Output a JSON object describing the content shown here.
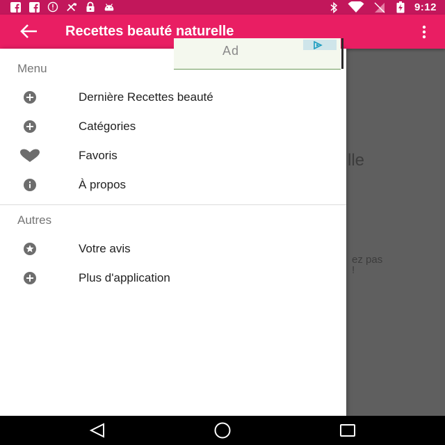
{
  "status_bar": {
    "time": "9:12",
    "left_icons": [
      "facebook-icon",
      "facebook-icon",
      "info-icon",
      "no-signal-icon",
      "lock-icon",
      "android-icon"
    ],
    "right_icons": [
      "bluetooth-icon",
      "wifi-icon",
      "no-sim-icon",
      "battery-charging-icon"
    ]
  },
  "app_bar": {
    "title": "Recettes beauté naturelle",
    "back_icon": "arrow-back-icon",
    "overflow_icon": "more-vert-icon",
    "color": "#e91e63"
  },
  "ad": {
    "label": "Ad"
  },
  "background_content": {
    "text_1": "lle",
    "text_2_line1": "ez pas",
    "text_2_line2": "!"
  },
  "drawer": {
    "sections": [
      {
        "header": "Menu",
        "items": [
          {
            "label": "Dernière Recettes beauté",
            "icon": "add-circle-icon"
          },
          {
            "label": "Catégories",
            "icon": "add-circle-icon"
          },
          {
            "label": "Favoris",
            "icon": "heart-icon"
          },
          {
            "label": "À propos",
            "icon": "info-circle-icon"
          }
        ]
      },
      {
        "header": "Autres",
        "items": [
          {
            "label": "Votre avis",
            "icon": "star-circle-icon"
          },
          {
            "label": "Plus d'application",
            "icon": "add-circle-icon"
          }
        ]
      }
    ]
  },
  "nav_bar": {
    "buttons": [
      "back-nav-icon",
      "home-nav-icon",
      "recents-nav-icon"
    ]
  }
}
